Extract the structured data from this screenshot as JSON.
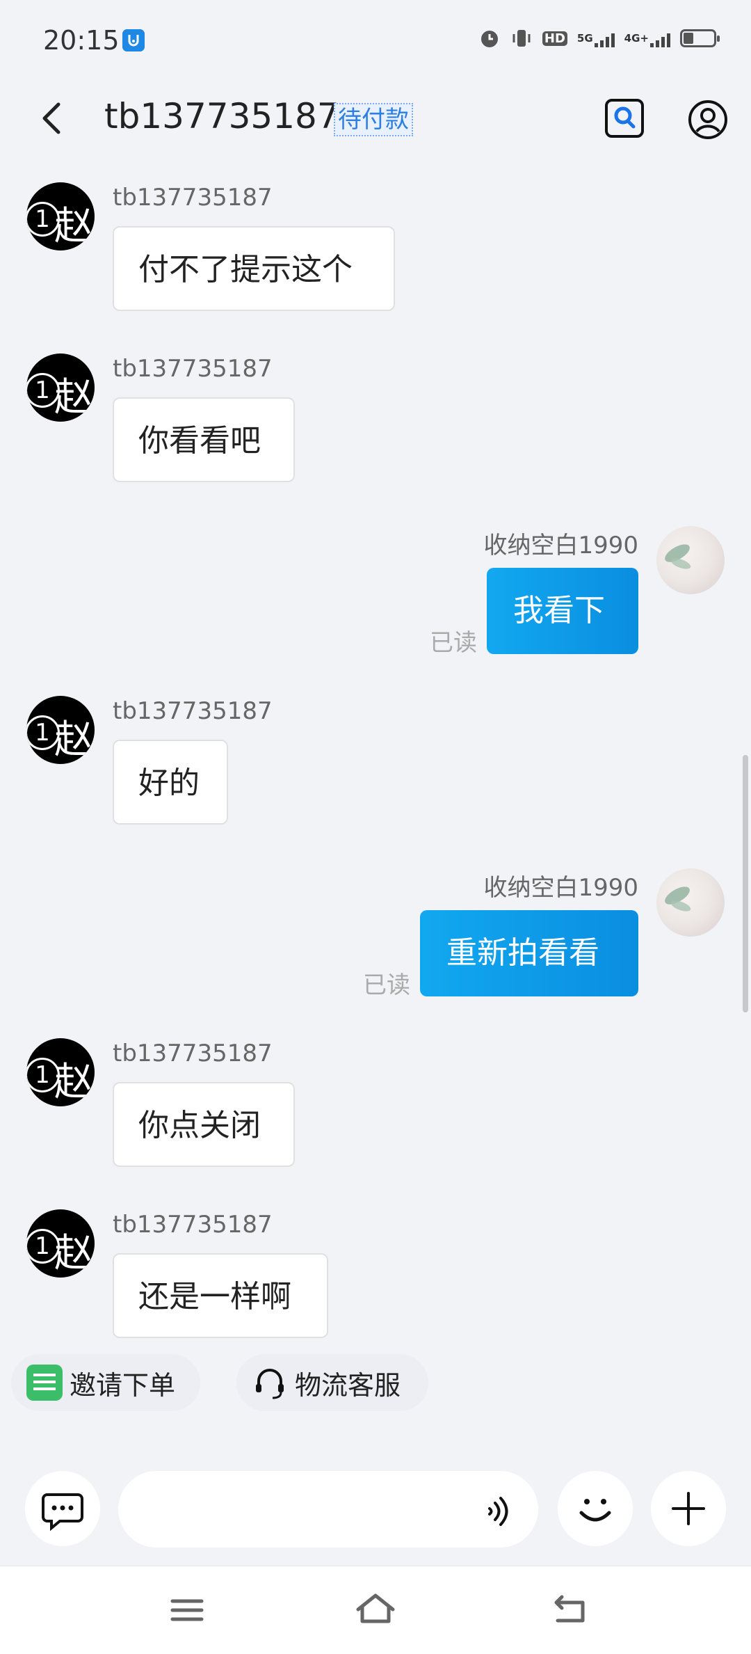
{
  "status_bar": {
    "time": "20:15",
    "app_icon": "shield-icon",
    "hd_label": "HD",
    "network_5g": "5G",
    "network_4g": "4G+"
  },
  "header": {
    "title": "tb137735187",
    "order_status": "待付款"
  },
  "messages": [
    {
      "side": "left",
      "sender": "tb137735187",
      "text": "付不了提示这个"
    },
    {
      "side": "left",
      "sender": "tb137735187",
      "text": "你看看吧"
    },
    {
      "side": "right",
      "sender": "收纳空白1990",
      "text": "我看下",
      "read": "已读"
    },
    {
      "side": "left",
      "sender": "tb137735187",
      "text": "好的"
    },
    {
      "side": "right",
      "sender": "收纳空白1990",
      "text": "重新拍看看",
      "read": "已读"
    },
    {
      "side": "left",
      "sender": "tb137735187",
      "text": "你点关闭"
    },
    {
      "side": "left",
      "sender": "tb137735187",
      "text": "还是一样啊"
    }
  ],
  "avatar_left": {
    "number": "1",
    "char": "赵"
  },
  "quick_actions": {
    "invite": "邀请下单",
    "logistics": "物流客服"
  },
  "input": {
    "value": "",
    "placeholder": ""
  },
  "colors": {
    "accent": "#0a8ee0",
    "background": "#f1f3f7",
    "invite_icon": "#3cbd6a"
  }
}
